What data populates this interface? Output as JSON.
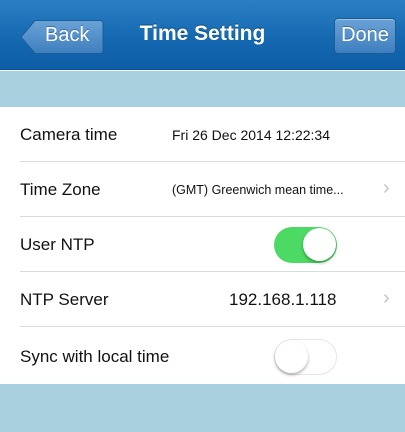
{
  "navbar": {
    "title": "Time Setting",
    "back_label": "Back",
    "done_label": "Done",
    "color": "#1569b1"
  },
  "settings": {
    "camera_time": {
      "label": "Camera time",
      "value": "Fri 26 Dec 2014  12:22:34"
    },
    "time_zone": {
      "label": "Time Zone",
      "value": "(GMT) Greenwich mean time..."
    },
    "user_ntp": {
      "label": "User NTP",
      "enabled": true
    },
    "ntp_server": {
      "label": "NTP Server",
      "value": "192.168.1.118"
    },
    "sync_local": {
      "label": "Sync with local time",
      "enabled": false
    }
  },
  "colors": {
    "section_band": "#a8d0df",
    "toggle_on": "#4cd964"
  },
  "icons": {
    "back": "back-arrow-icon",
    "disclosure": "chevron-right-icon"
  }
}
